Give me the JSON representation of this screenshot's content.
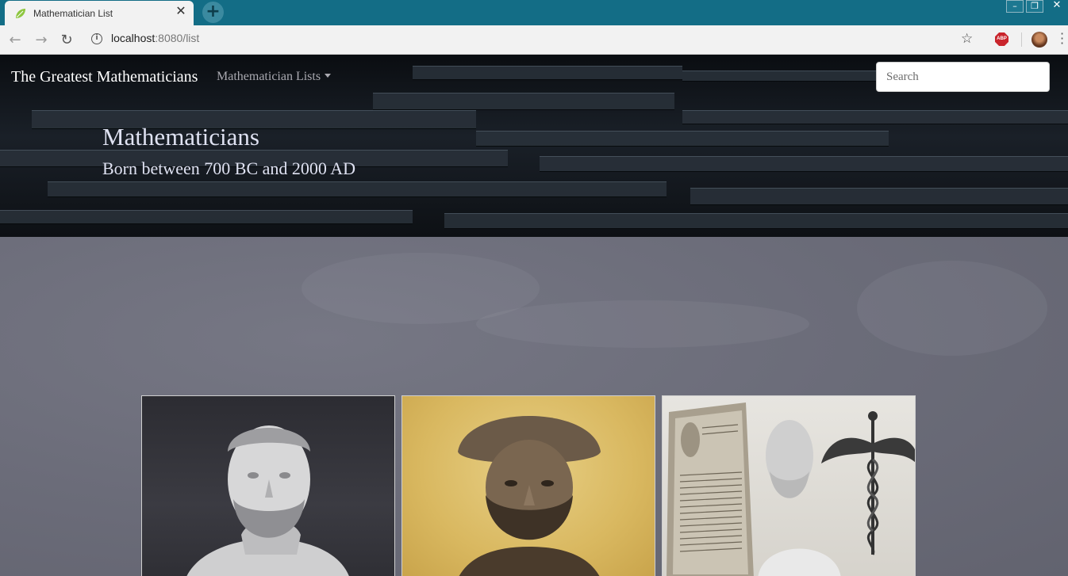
{
  "browser": {
    "tab_title": "Mathematician List",
    "url_host": "localhost",
    "url_rest": ":8080/list",
    "extension_label": "ABP"
  },
  "navbar": {
    "brand": "The Greatest Mathematicians",
    "dropdown_label": "Mathematician Lists",
    "search_placeholder": "Search"
  },
  "hero": {
    "title": "Mathematicians",
    "subtitle": "Born between 700 BC and 2000 AD"
  },
  "cards": [
    {
      "image": "marble-bust-bearded-man"
    },
    {
      "image": "bronze-bust-turbaned-man"
    },
    {
      "image": "hippocrates-bust-with-tablet-and-caduceus"
    }
  ],
  "colors": {
    "titlebar": "#136d86",
    "hero_text": "#dfe2f2",
    "board": "#6b6c78"
  }
}
